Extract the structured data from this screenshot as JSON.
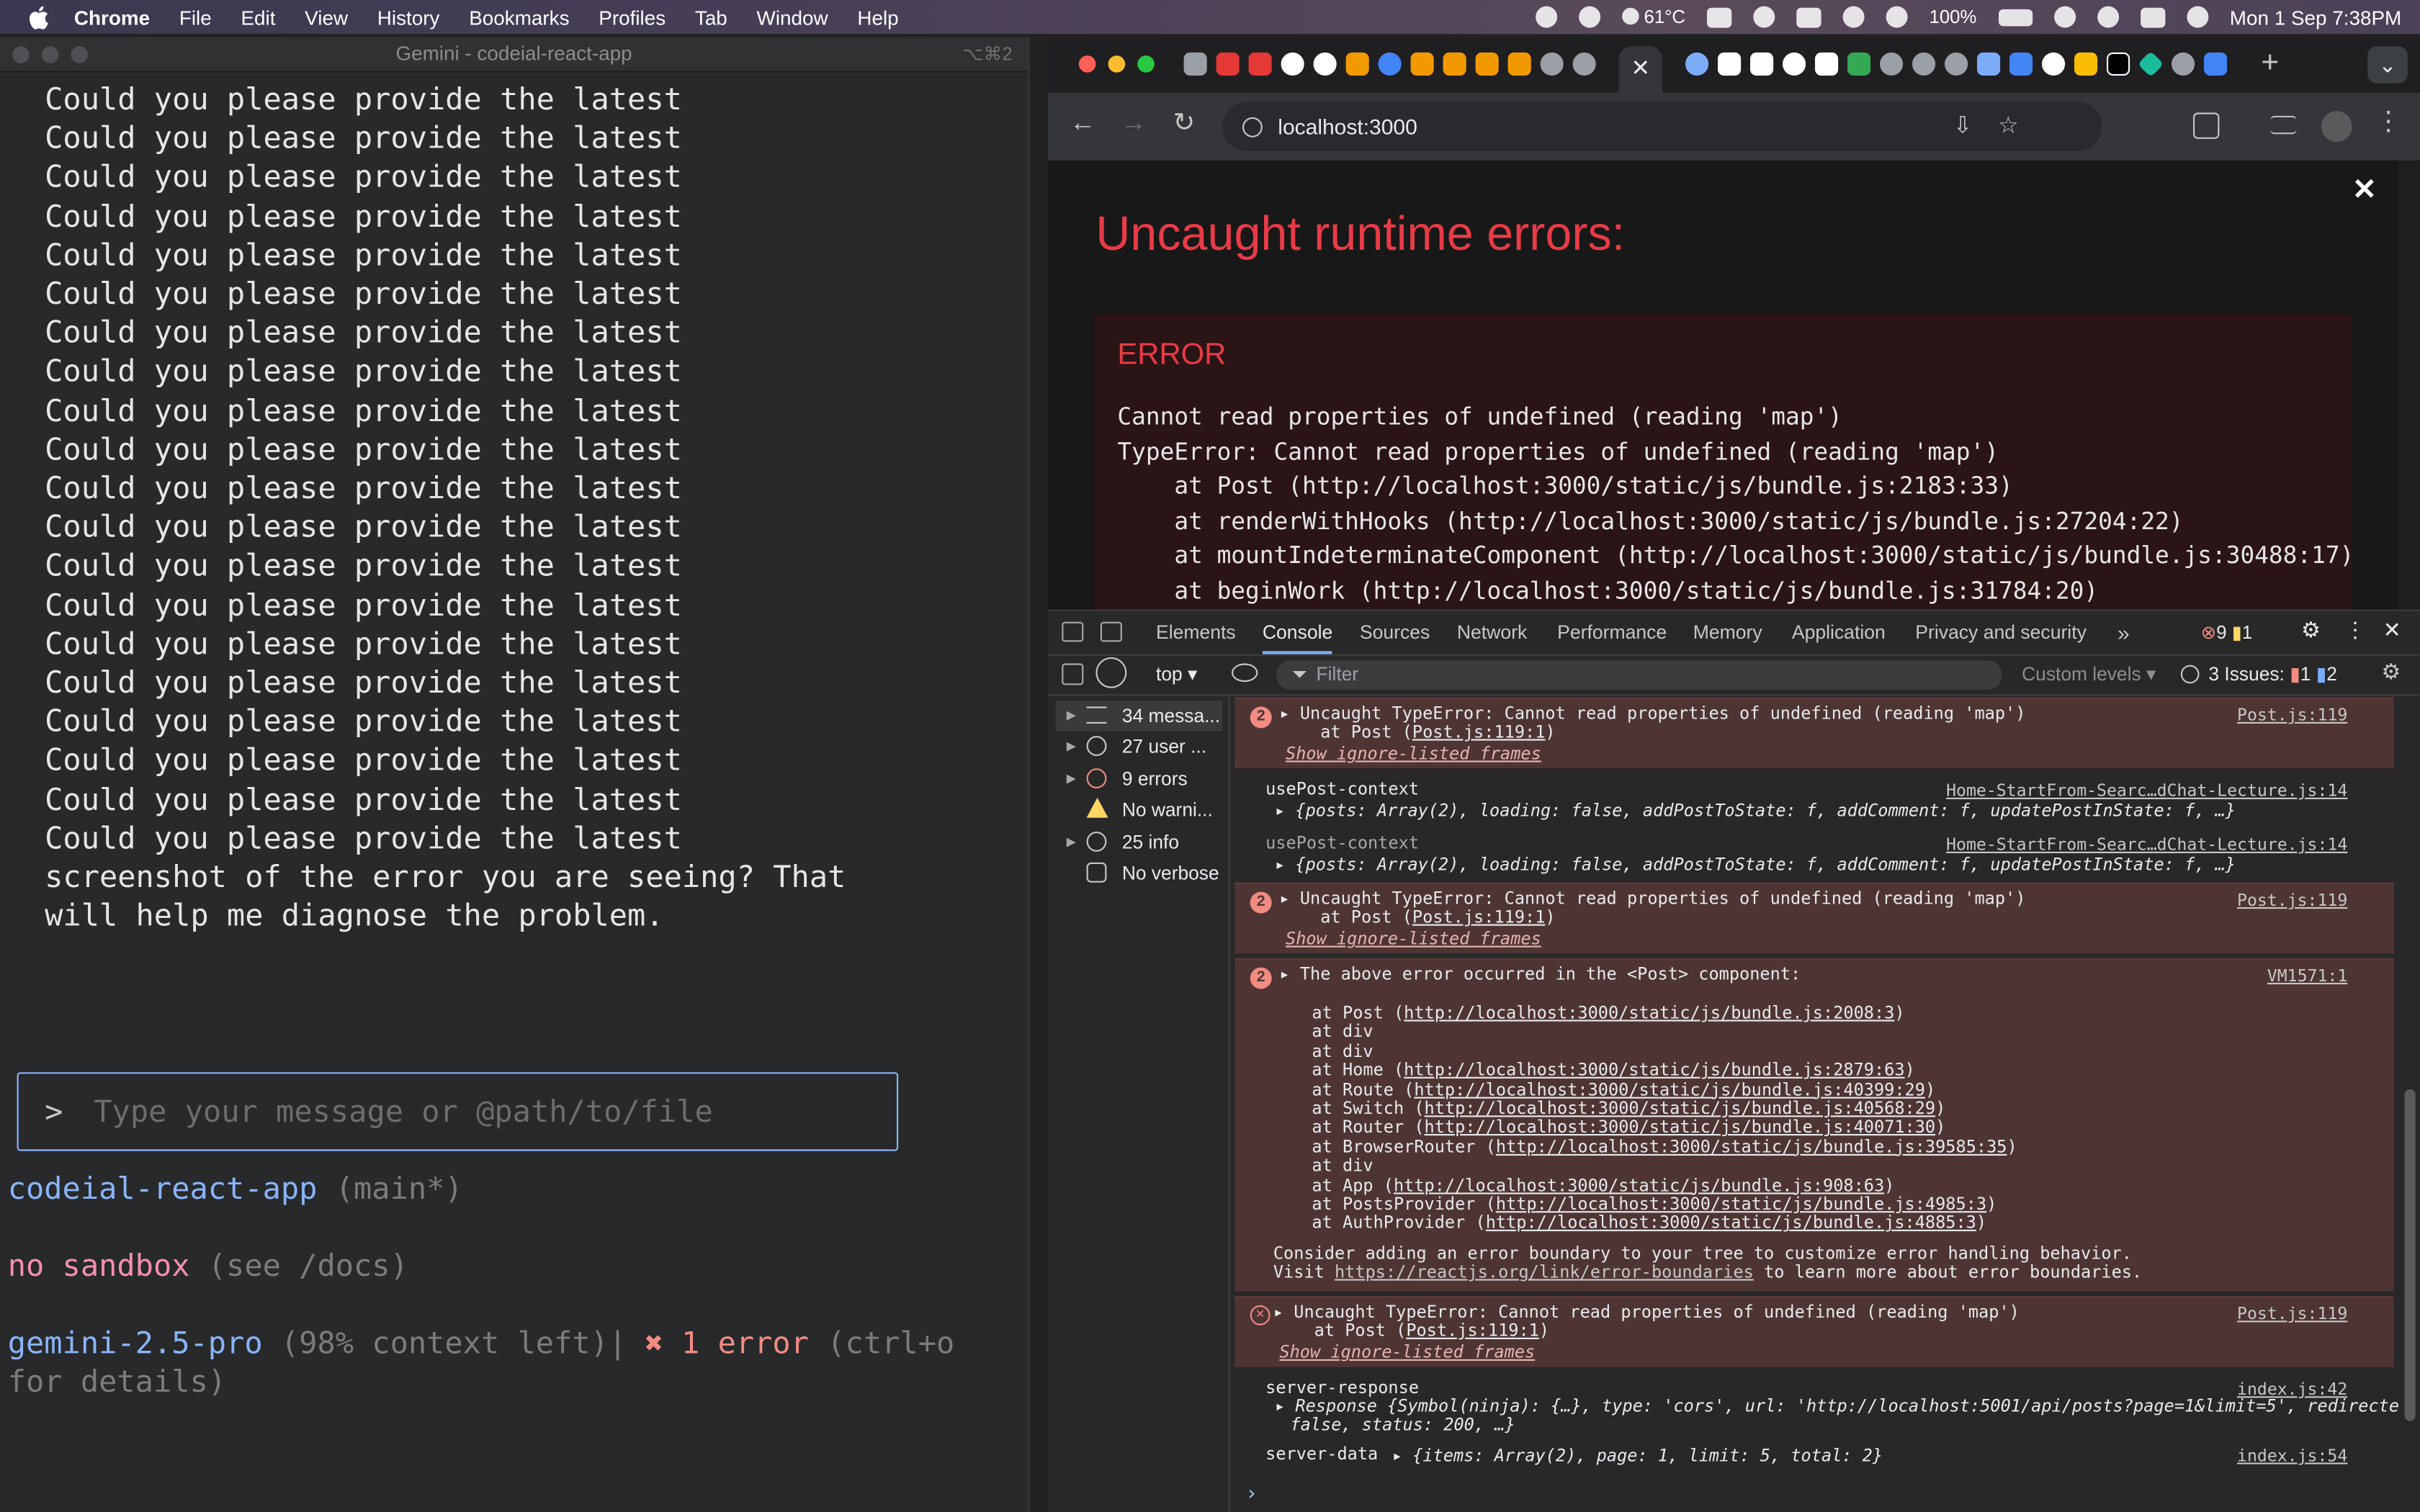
{
  "menubar": {
    "items": [
      "Chrome",
      "File",
      "Edit",
      "View",
      "History",
      "Bookmarks",
      "Profiles",
      "Tab",
      "Window",
      "Help"
    ],
    "weather": "61°C",
    "battery": "100%",
    "datetime": "Mon 1 Sep  7:38PM"
  },
  "terminal": {
    "title": "Gemini - codeial-react-app",
    "shortcut": "⌥⌘2",
    "repeated_line": "Could you please provide the latest",
    "tail_line_1": "screenshot of the error you are seeing? That",
    "tail_line_2": "will help me diagnose the problem.",
    "prompt_symbol": ">",
    "input_placeholder": "Type your message or @path/to/file",
    "repo": "codeial-react-app",
    "branch": "(main*)",
    "sandbox": "no sandbox",
    "sandbox_hint": "(see /docs)",
    "model": "gemini-2.5-pro",
    "context": "(98% context left)|",
    "error_count": "✖ 1 error",
    "error_hint_1": "(ctrl+o",
    "error_hint_2": "for details)"
  },
  "browser": {
    "url": "localhost:3000",
    "overlay": {
      "title": "Uncaught runtime errors:",
      "label": "ERROR",
      "trace": [
        "Cannot read properties of undefined (reading 'map')",
        "TypeError: Cannot read properties of undefined (reading 'map')",
        "    at Post (http://localhost:3000/static/js/bundle.js:2183:33)",
        "    at renderWithHooks (http://localhost:3000/static/js/bundle.js:27204:22)",
        "    at mountIndeterminateComponent (http://localhost:3000/static/js/bundle.js:30488:17)",
        "    at beginWork (http://localhost:3000/static/js/bundle.js:31784:20)"
      ]
    }
  },
  "devtools": {
    "tabs": [
      "Elements",
      "Console",
      "Sources",
      "Network",
      "Performance",
      "Memory",
      "Application",
      "Privacy and security"
    ],
    "more": "»",
    "error_count": "9",
    "warn_count": "1",
    "context": "top ▾",
    "filter_placeholder": "Filter",
    "levels": "Custom levels ▾",
    "issues_label": "3 Issues:",
    "issues_err": "1",
    "issues_info": "2",
    "sidebar": [
      {
        "label": "34 messa...",
        "icon": "list-icon"
      },
      {
        "label": "27 user ...",
        "icon": "user-icon"
      },
      {
        "label": "9 errors",
        "icon": "error-icon"
      },
      {
        "label": "No warni...",
        "icon": "warning-icon"
      },
      {
        "label": "25 info",
        "icon": "info-icon"
      },
      {
        "label": "No verbose",
        "icon": "bug-icon"
      }
    ],
    "log": {
      "e1_count": "2",
      "e1_text": "Uncaught TypeError: Cannot read properties of undefined (reading 'map')",
      "e1_at": "    at Post (",
      "e1_loc": "Post.js:119:1",
      "e1_close": ")",
      "ignore": "Show ignore-listed frames",
      "post_src": "Post.js:119",
      "ctx_label": "usePost-context",
      "ctx_src": "Home-StartFrom-Searc…dChat-Lecture.js:14",
      "ctx_obj": "▸ {posts: Array(2), loading: false, addPostToState: f, addComment: f, updatePostInState: f, …}",
      "e3_text": "The above error occurred in the <Post> component:",
      "e3_src": "VM1571:1",
      "stack": [
        {
          "pre": "at Post (",
          "url": "http://localhost:3000/static/js/bundle.js:2008:3",
          "post": ")"
        },
        {
          "pre": "at div",
          "url": "",
          "post": ""
        },
        {
          "pre": "at div",
          "url": "",
          "post": ""
        },
        {
          "pre": "at Home (",
          "url": "http://localhost:3000/static/js/bundle.js:2879:63",
          "post": ")"
        },
        {
          "pre": "at Route (",
          "url": "http://localhost:3000/static/js/bundle.js:40399:29",
          "post": ")"
        },
        {
          "pre": "at Switch (",
          "url": "http://localhost:3000/static/js/bundle.js:40568:29",
          "post": ")"
        },
        {
          "pre": "at Router (",
          "url": "http://localhost:3000/static/js/bundle.js:40071:30",
          "post": ")"
        },
        {
          "pre": "at BrowserRouter (",
          "url": "http://localhost:3000/static/js/bundle.js:39585:35",
          "post": ")"
        },
        {
          "pre": "at div",
          "url": "",
          "post": ""
        },
        {
          "pre": "at App (",
          "url": "http://localhost:3000/static/js/bundle.js:908:63",
          "post": ")"
        },
        {
          "pre": "at PostsProvider (",
          "url": "http://localhost:3000/static/js/bundle.js:4985:3",
          "post": ")"
        },
        {
          "pre": "at AuthProvider (",
          "url": "http://localhost:3000/static/js/bundle.js:4885:3",
          "post": ")"
        }
      ],
      "boundary_1": "Consider adding an error boundary to your tree to customize error handling behavior.",
      "boundary_2a": "Visit ",
      "boundary_link": "https://reactjs.org/link/error-boundaries",
      "boundary_2b": " to learn more about error boundaries.",
      "resp_label": "server-response",
      "resp_src": "index.js:42",
      "resp_obj_1": "▸ Response {Symbol(ninja): {…}, type: 'cors', url: 'http://localhost:5001/api/posts?page=1&limit=5', redirected:",
      "resp_obj_2": "false, status: 200, …}",
      "data_label": "server-data",
      "data_obj": "▸ {items: Array(2), page: 1, limit: 5, total: 2}",
      "data_src": "index.js:54",
      "prompt": "›"
    }
  }
}
